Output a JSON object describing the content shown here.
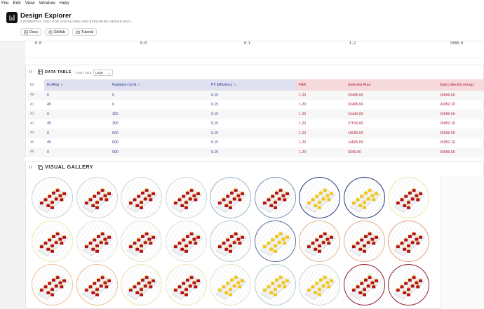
{
  "menu": [
    "File",
    "Edit",
    "View",
    "Window",
    "Help"
  ],
  "app": {
    "title": "Design Explorer",
    "subtitle": "A POWERFUL TOOL FOR VISUALIZING AND EXPLORING DESIGN DATA",
    "buttons": [
      {
        "label": "Docs",
        "icon": "docs-icon"
      },
      {
        "label": "GitHub",
        "icon": "github-icon"
      },
      {
        "label": "Tutorial",
        "icon": "tutorial-icon"
      }
    ]
  },
  "top_values": [
    "0.0",
    "0.0",
    "0.1",
    "1.2",
    "9340.0"
  ],
  "data_table": {
    "title": "DATA TABLE",
    "font_size_label": "FONT SIZE",
    "font_size_value": "Large",
    "columns": [
      {
        "label": "ID",
        "kind": "id"
      },
      {
        "label": "RotAng",
        "kind": "in"
      },
      {
        "label": "Radiation Limit",
        "kind": "in"
      },
      {
        "label": "PV Efficiency",
        "kind": "in"
      },
      {
        "label": "FAR",
        "kind": "out"
      },
      {
        "label": "Selected Area",
        "kind": "out"
      },
      {
        "label": "total collected energy",
        "kind": "out"
      }
    ],
    "rows": [
      [
        "#0",
        "0",
        "0",
        "0.15",
        "1.20",
        "33495.00",
        "24556.50"
      ],
      [
        "#1",
        "45",
        "0",
        "0.15",
        "1.20",
        "33495.00",
        "24952.10"
      ],
      [
        "#2",
        "0",
        "300",
        "0.15",
        "1.20",
        "24440.00",
        "24556.50"
      ],
      [
        "#3",
        "45",
        "300",
        "0.15",
        "1.20",
        "27510.00",
        "24952.10"
      ],
      [
        "#4",
        "0",
        "600",
        "0.15",
        "1.20",
        "18290.00",
        "24556.50"
      ],
      [
        "#5",
        "45",
        "600",
        "0.15",
        "1.20",
        "14825.00",
        "24952.10"
      ],
      [
        "#6",
        "0",
        "900",
        "0.15",
        "1.20",
        "9340.00",
        "24556.50"
      ]
    ]
  },
  "gallery": {
    "title": "VISUAL GALLERY",
    "ring_colors": [
      "#c9ced6",
      "#c9d6d9",
      "#cfd9d6",
      "#c8d9db",
      "#9bb6c9",
      "#7f93b8",
      "#2e3a7a",
      "#2a3678",
      "#f1e9a8",
      "#f2eab0",
      "#e3e6d6",
      "#e6e3c8",
      "#dfe3d8",
      "#b6ccd6",
      "#5b6e9a",
      "#e6b68f",
      "#e8b08c",
      "#e3a283",
      "#f0c49a",
      "#ecbf92",
      "#eee3b0",
      "#efe5b6",
      "#e6e5c8",
      "#b3cbd4",
      "#c9d6da",
      "#8e1c2c",
      "#8f1f2f"
    ],
    "thumb_variants": [
      "red",
      "red",
      "red",
      "red",
      "red",
      "red",
      "yellow",
      "yellow",
      "red",
      "red",
      "red",
      "red",
      "red",
      "red",
      "yellow",
      "red",
      "red",
      "red",
      "red",
      "red",
      "red",
      "red",
      "yellow",
      "yellow",
      "yellow",
      "red",
      "red"
    ]
  }
}
